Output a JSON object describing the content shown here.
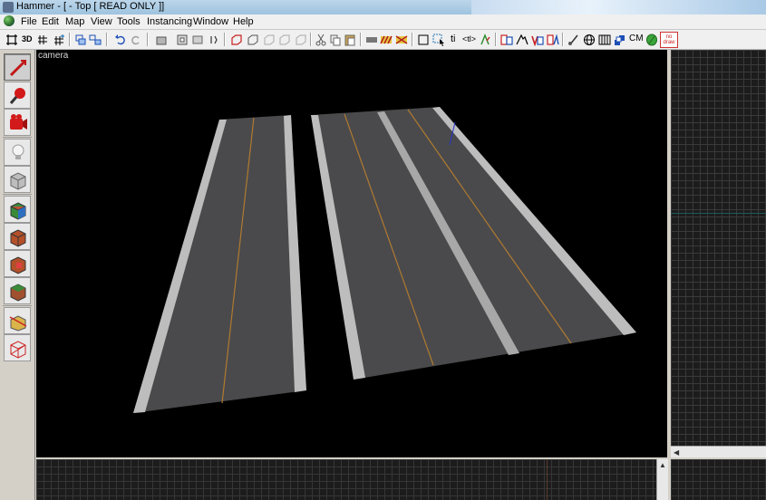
{
  "window": {
    "title": "Hammer - [ - Top [ READ ONLY ]]"
  },
  "menu": [
    "File",
    "Edit",
    "Map",
    "View",
    "Tools",
    "Instancing",
    "Window",
    "Help"
  ],
  "toolbar": {
    "text_buttons": {
      "three_d": "3D",
      "ti": "ti",
      "tl": "<tl>",
      "cm": "CM",
      "draw": "no draw"
    }
  },
  "viewport": {
    "label": "camera"
  },
  "colors": {
    "road": "#4a4a4c",
    "road_edge": "#bdbdbd",
    "center_line": "#b07a30",
    "grid_line": "#3a3a3a",
    "viewport_bg": "#000000"
  },
  "left_tools": [
    "selection-tool",
    "magnify-tool",
    "camera-tool",
    "entity-tool",
    "block-tool",
    "texture-application-tool",
    "apply-current-texture-tool",
    "decal-tool",
    "overlay-tool",
    "clipping-tool",
    "vertex-manipulation-tool"
  ]
}
